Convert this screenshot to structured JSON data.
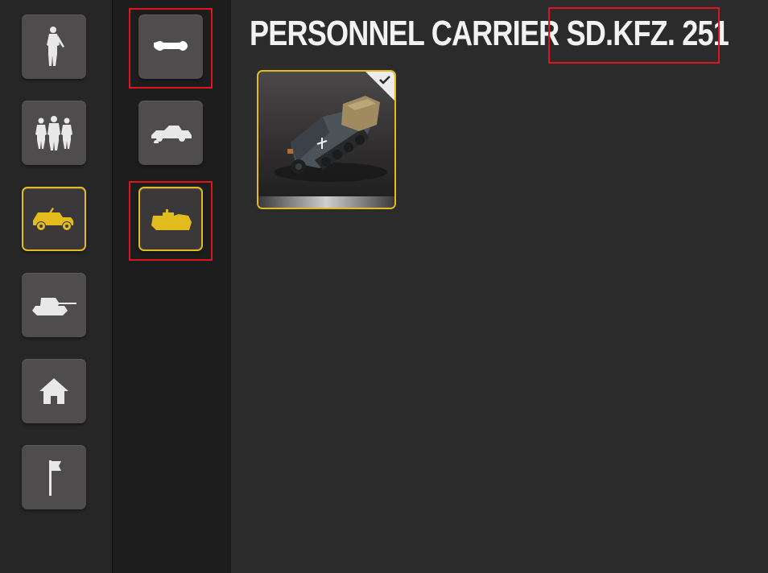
{
  "header": {
    "title": "PERSONNEL CARRIER SD.KFZ. 251"
  },
  "categories": [
    {
      "name": "soldier",
      "icon": "soldier-icon",
      "active": false
    },
    {
      "name": "squad",
      "icon": "squad-icon",
      "active": false
    },
    {
      "name": "vehicle",
      "icon": "jeep-icon",
      "active": true
    },
    {
      "name": "tank",
      "icon": "tank-icon",
      "active": false
    },
    {
      "name": "building",
      "icon": "house-icon",
      "active": false
    },
    {
      "name": "flag",
      "icon": "flag-icon",
      "active": false
    }
  ],
  "subcategories": [
    {
      "icon": "truck-icon",
      "active": false,
      "highlighted": true
    },
    {
      "icon": "armored-car-icon",
      "active": false,
      "highlighted": false
    },
    {
      "icon": "halftrack-icon",
      "active": true,
      "highlighted": true
    }
  ],
  "units": [
    {
      "icon": "halftrack-unit-icon",
      "selected": true,
      "checked": true
    }
  ],
  "colors": {
    "accent": "#e2bb1f",
    "highlight": "#e0141c",
    "tile": "#4e4c4c"
  }
}
